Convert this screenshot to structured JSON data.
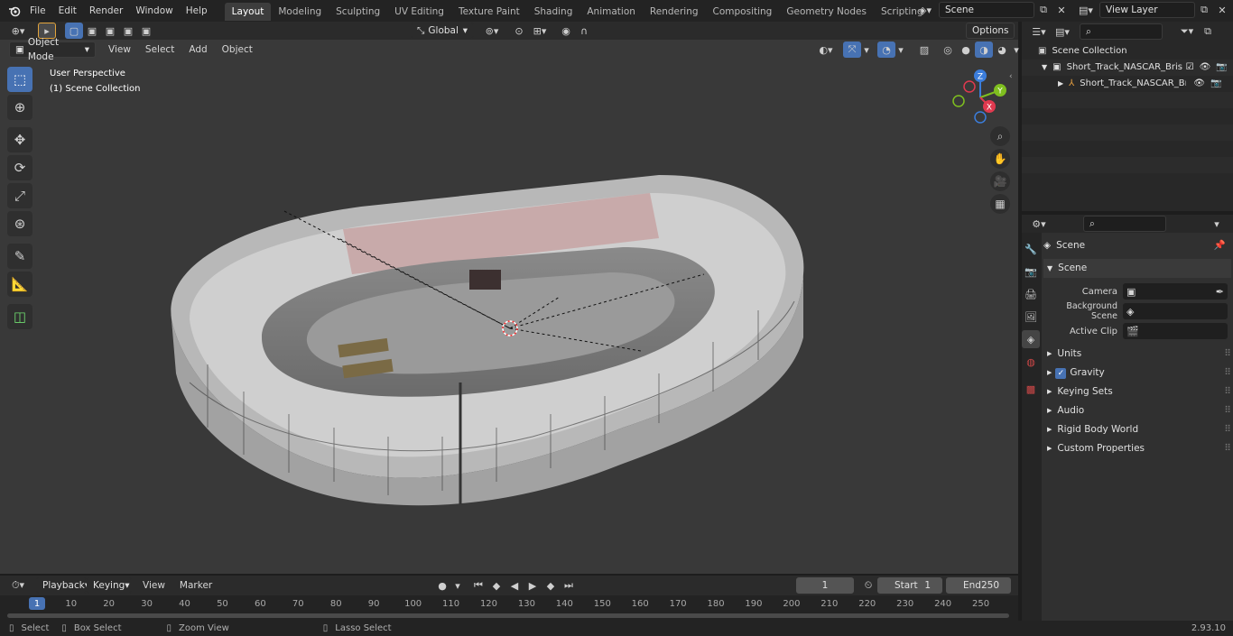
{
  "topbar": {
    "menus": [
      "File",
      "Edit",
      "Render",
      "Window",
      "Help"
    ],
    "workspaces": [
      "Layout",
      "Modeling",
      "Sculpting",
      "UV Editing",
      "Texture Paint",
      "Shading",
      "Animation",
      "Rendering",
      "Compositing",
      "Geometry Nodes",
      "Scripting"
    ],
    "active_workspace": "Layout",
    "add_tab": "+",
    "scene_name": "Scene",
    "view_layer": "View Layer"
  },
  "viewport": {
    "mode": "Object Mode",
    "menus": [
      "View",
      "Select",
      "Add",
      "Object"
    ],
    "orientation": "Global",
    "options_label": "Options",
    "perspective_label": "User Perspective",
    "collection_label": "(1) Scene Collection",
    "gizmo": {
      "z": "Z",
      "y": "Y",
      "x": "X"
    }
  },
  "outliner": {
    "root": "Scene Collection",
    "items": [
      {
        "label": "Short_Track_NASCAR_Bristol_"
      },
      {
        "label": "Short_Track_NASCAR_Br"
      }
    ]
  },
  "properties": {
    "context": "Scene",
    "section": "Scene",
    "fields": [
      {
        "label": "Camera"
      },
      {
        "label": "Background Scene"
      },
      {
        "label": "Active Clip"
      }
    ],
    "panels": [
      "Units",
      "Gravity",
      "Keying Sets",
      "Audio",
      "Rigid Body World",
      "Custom Properties"
    ]
  },
  "timeline": {
    "menus": [
      "Playback",
      "Keying",
      "View",
      "Marker"
    ],
    "current_frame": "1",
    "start_label": "Start",
    "start": "1",
    "end_label": "End",
    "end": "250",
    "ticks": [
      "1",
      "10",
      "20",
      "30",
      "40",
      "50",
      "60",
      "70",
      "80",
      "90",
      "100",
      "110",
      "120",
      "130",
      "140",
      "150",
      "160",
      "170",
      "180",
      "190",
      "200",
      "210",
      "220",
      "230",
      "240",
      "250"
    ]
  },
  "status": {
    "select": "Select",
    "box_select": "Box Select",
    "zoom_view": "Zoom View",
    "lasso_select": "Lasso Select",
    "version": "2.93.10"
  },
  "colors": {
    "accent": "#4772b3",
    "viewport_bg": "#393939",
    "axis_x": "#e0394f",
    "axis_y": "#7fbf1f",
    "axis_z": "#3b7ddb"
  }
}
